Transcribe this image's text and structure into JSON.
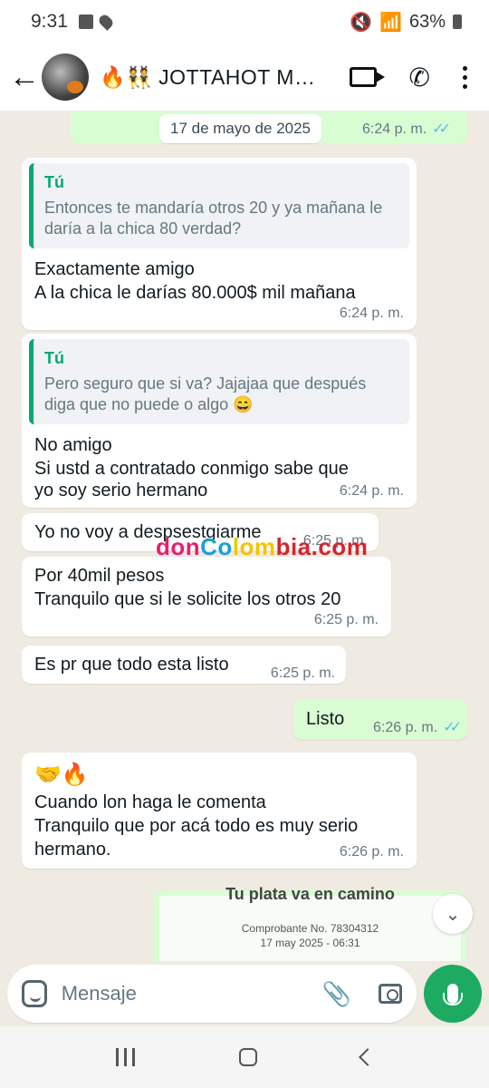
{
  "status_bar": {
    "time": "9:31",
    "battery": "63%"
  },
  "header": {
    "chat_name": "🔥👯 JOTTAHOT MANIZALES"
  },
  "date_chip": "17 de mayo de 2025",
  "top_out_time": "6:24 p. m.",
  "messages": [
    {
      "quote_author": "Tú",
      "quote_text": "Entonces te mandaría otros 20 y ya mañana le daría a la chica 80 verdad?",
      "line1": "Exactamente amigo",
      "line2": "A la chica le darías 80.000$ mil mañana",
      "time": "6:24 p. m."
    },
    {
      "quote_author": "Tú",
      "quote_text": "Pero seguro que si va? Jajajaa que después diga que no puede o algo 😄",
      "line1": "No amigo",
      "line2": "Si ustd a contratado conmigo sabe que",
      "line3": "yo soy serio hermano",
      "time": "6:24 p. m."
    },
    {
      "text": "Yo no voy a despsestgiarme",
      "time": "6:25 p. m."
    },
    {
      "line1": "Por 40mil pesos",
      "line2": "Tranquilo que si le solicite los otros 20",
      "time": "6:25 p. m."
    },
    {
      "text": "Es pr que todo esta listo",
      "time": "6:25 p. m."
    },
    {
      "text": "Listo",
      "time": "6:26 p. m."
    },
    {
      "emoji": "🤝🔥",
      "line1": "Cuando lon haga le comenta",
      "line2": "Tranquilo que por acá todo es muy serio",
      "line3": "hermano.",
      "time": "6:26 p. m."
    }
  ],
  "watermark": {
    "p1": "don",
    "p2": "Co",
    "p3": "lom",
    "p4": "bia.com"
  },
  "receipt": {
    "title": "Tu plata va en camino",
    "number": "Comprobante No. 78304312",
    "date": "17 may 2025 - 06:31"
  },
  "input": {
    "placeholder": "Mensaje"
  }
}
